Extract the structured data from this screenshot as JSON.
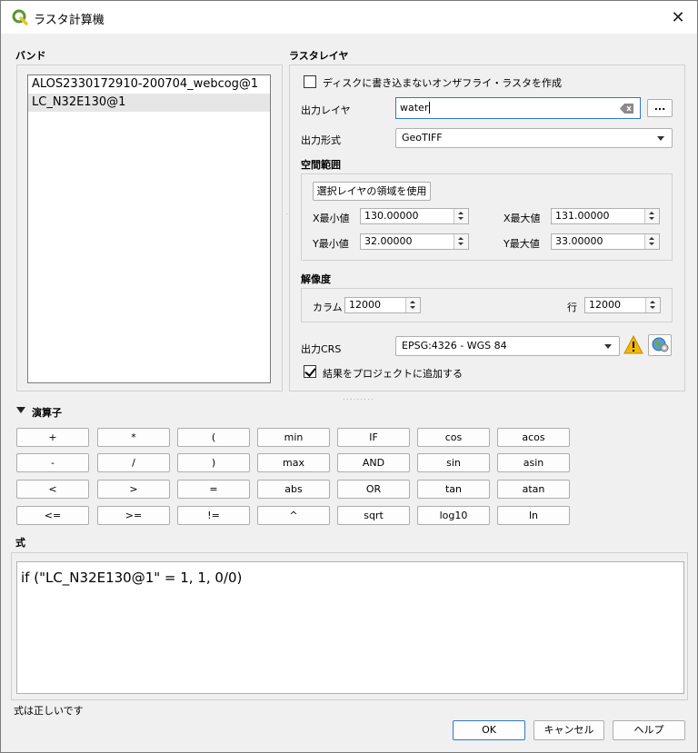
{
  "window": {
    "title": "ラスタ計算機",
    "close_label": "✕"
  },
  "bands": {
    "label": "バンド",
    "items": [
      "ALOS2330172910-200704_webcog@1",
      "LC_N32E130@1"
    ],
    "selected_index": 1
  },
  "raster_layer": {
    "label": "ラスタレイヤ",
    "onfly_label": "ディスクに書き込まないオンザフライ・ラスタを作成",
    "onfly_checked": false,
    "output_layer_label": "出力レイヤ",
    "output_layer_value": "water",
    "browse_label": "...",
    "output_format_label": "出力形式",
    "output_format_value": "GeoTIFF",
    "extent_label": "空間範囲",
    "use_selected_extent_label": "選択レイヤの領域を使用",
    "xmin_label": "X最小値",
    "xmin_value": "130.00000",
    "xmax_label": "X最大値",
    "xmax_value": "131.00000",
    "ymin_label": "Y最小値",
    "ymin_value": "32.00000",
    "ymax_label": "Y最大値",
    "ymax_value": "33.00000",
    "resolution_label": "解像度",
    "columns_label": "カラム",
    "columns_value": "12000",
    "rows_label": "行",
    "rows_value": "12000",
    "crs_label": "出力CRS",
    "crs_value": "EPSG:4326 - WGS 84",
    "add_to_project_label": "結果をプロジェクトに追加する",
    "add_to_project_checked": true
  },
  "operators": {
    "label": "演算子",
    "rows": [
      [
        "+",
        "*",
        "(",
        "min",
        "IF",
        "cos",
        "acos"
      ],
      [
        "-",
        "/",
        ")",
        "max",
        "AND",
        "sin",
        "asin"
      ],
      [
        "<",
        ">",
        "=",
        "abs",
        "OR",
        "tan",
        "atan"
      ],
      [
        "<=",
        ">=",
        "!=",
        "^",
        "sqrt",
        "log10",
        "ln"
      ]
    ]
  },
  "expression": {
    "label": "式",
    "value": "if (\"LC_N32E130@1\" = 1, 1, 0/0)",
    "status": "式は正しいです"
  },
  "buttons": {
    "ok": "OK",
    "cancel": "キャンセル",
    "help": "ヘルプ"
  },
  "colors": {
    "accent": "#2d79c7",
    "warning": "#f2b705",
    "qgis_green": "#589632"
  }
}
